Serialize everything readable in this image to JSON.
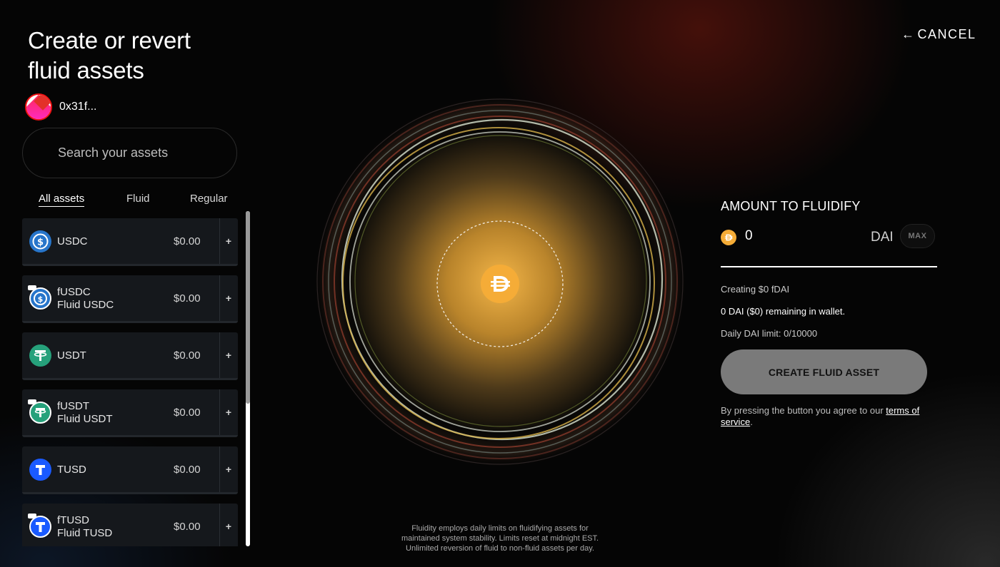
{
  "page": {
    "title_line1": "Create or revert",
    "title_line2": "fluid assets",
    "cancel_label": "CANCEL"
  },
  "wallet": {
    "address": "0x31f..."
  },
  "search": {
    "placeholder": "Search your assets"
  },
  "tabs": [
    {
      "label": "All assets",
      "active": true
    },
    {
      "label": "Fluid",
      "active": false
    },
    {
      "label": "Regular",
      "active": false
    }
  ],
  "assets": [
    {
      "symbol": "USDC",
      "subtitle": "",
      "value": "$0.00",
      "icon": "usdc-icon",
      "color": "#2775ca",
      "fluid": false
    },
    {
      "symbol": "fUSDC",
      "subtitle": "Fluid USDC",
      "value": "$0.00",
      "icon": "fusdc-icon",
      "color": "#2775ca",
      "fluid": true
    },
    {
      "symbol": "USDT",
      "subtitle": "",
      "value": "$0.00",
      "icon": "usdt-icon",
      "color": "#26a17b",
      "fluid": false
    },
    {
      "symbol": "fUSDT",
      "subtitle": "Fluid USDT",
      "value": "$0.00",
      "icon": "fusdt-icon",
      "color": "#26a17b",
      "fluid": true
    },
    {
      "symbol": "TUSD",
      "subtitle": "",
      "value": "$0.00",
      "icon": "tusd-icon",
      "color": "#1a5aff",
      "fluid": false
    },
    {
      "symbol": "fTUSD",
      "subtitle": "Fluid TUSD",
      "value": "$0.00",
      "icon": "ftusd-icon",
      "color": "#1a5aff",
      "fluid": true
    }
  ],
  "add_button_label": "+",
  "fluidify": {
    "heading": "AMOUNT TO FLUIDIFY",
    "amount": "0",
    "token": "DAI",
    "max_label": "MAX",
    "creating_text": "Creating $0 fDAI",
    "remaining_text": "0 DAI ($0) remaining in wallet.",
    "limit_text": "Daily DAI limit: 0/10000",
    "button_label": "CREATE FLUID ASSET",
    "terms_prefix": "By pressing the button you agree to our ",
    "terms_link": "terms of service",
    "terms_suffix": "."
  },
  "footnote": {
    "line1": "Fluidity employs daily limits on fluidifying assets for",
    "line2": "maintained system stability. Limits reset at midnight EST.",
    "line3": "Unlimited reversion of fluid to non-fluid assets per day."
  },
  "colors": {
    "dai": "#f5ac37",
    "button_disabled": "#7a7a7a"
  }
}
